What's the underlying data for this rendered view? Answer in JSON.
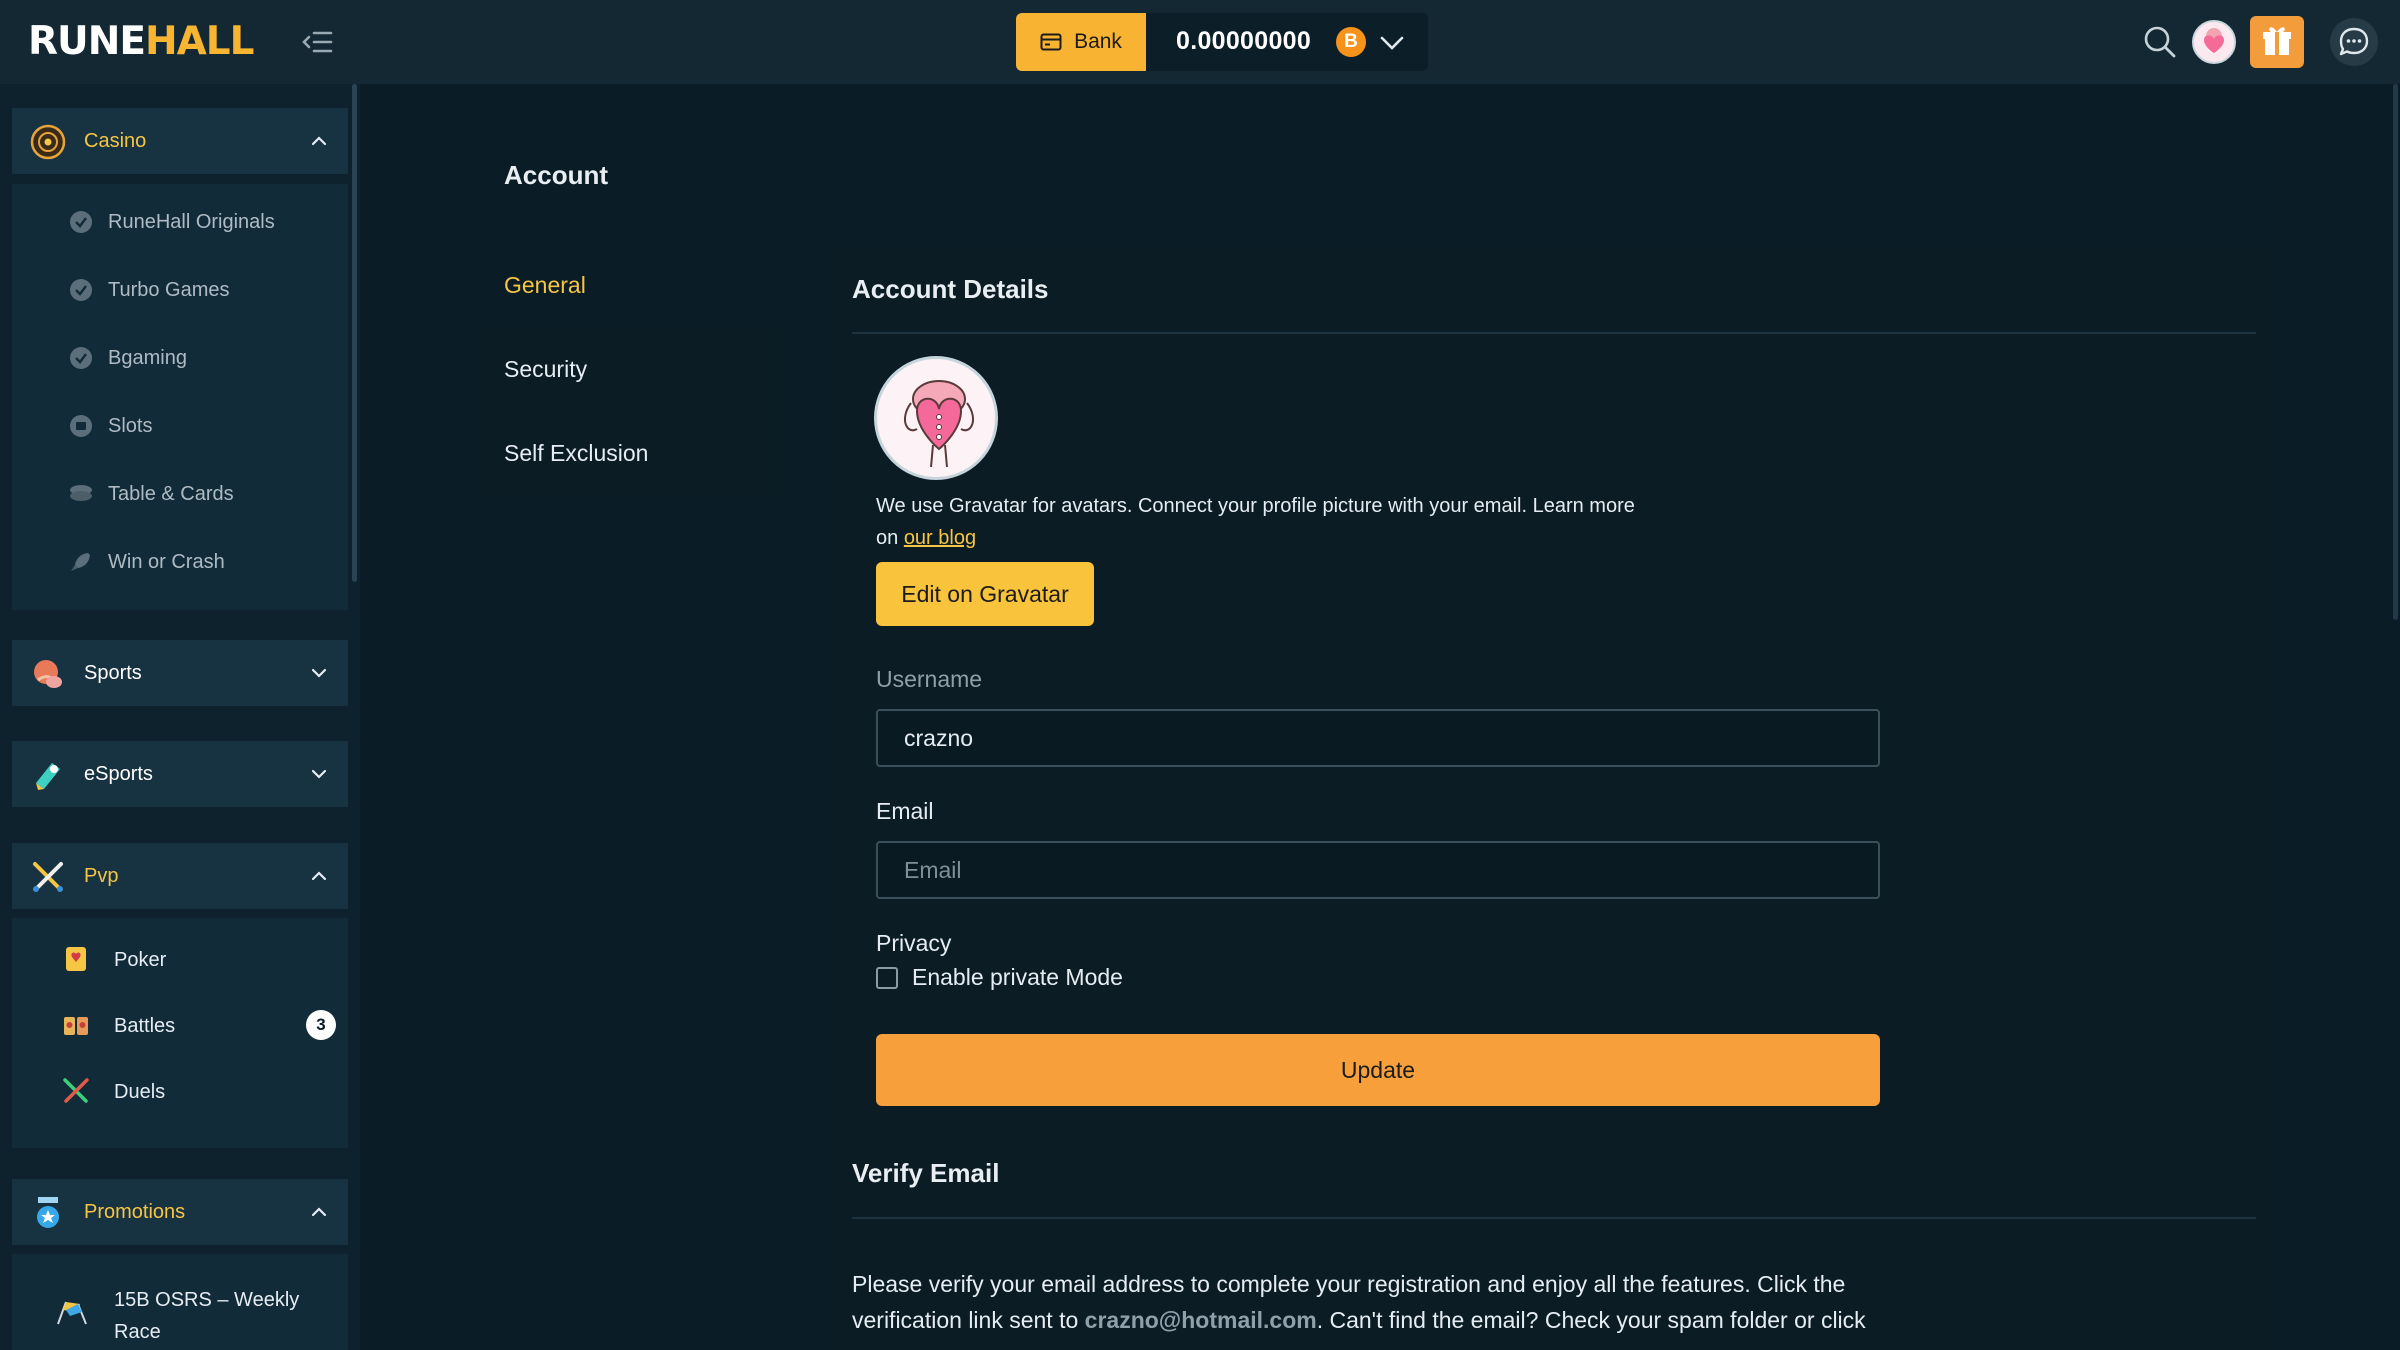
{
  "header": {
    "logo_part1": "RUNE",
    "logo_part2": "HALL",
    "bank_label": "Bank",
    "balance": "0.00000000",
    "currency_symbol": "B"
  },
  "sidebar": {
    "casino": {
      "label": "Casino",
      "items": [
        {
          "label": "RuneHall Originals"
        },
        {
          "label": "Turbo Games"
        },
        {
          "label": "Bgaming"
        },
        {
          "label": "Slots"
        },
        {
          "label": "Table & Cards"
        },
        {
          "label": "Win or Crash"
        }
      ]
    },
    "sports": {
      "label": "Sports"
    },
    "esports": {
      "label": "eSports"
    },
    "pvp": {
      "label": "Pvp",
      "items": [
        {
          "label": "Poker"
        },
        {
          "label": "Battles",
          "badge": "3"
        },
        {
          "label": "Duels"
        }
      ]
    },
    "promotions": {
      "label": "Promotions",
      "items": [
        {
          "label_line1": "15B OSRS – Weekly",
          "label_line2": "Race"
        }
      ]
    }
  },
  "main": {
    "title": "Account",
    "tabs": [
      {
        "label": "General",
        "active": true
      },
      {
        "label": "Security"
      },
      {
        "label": "Self Exclusion"
      }
    ],
    "account_details": {
      "heading": "Account Details",
      "gravatar_text": "We use Gravatar for avatars. Connect your profile picture with your email. Learn more on ",
      "gravatar_link": "our blog",
      "edit_button": "Edit on Gravatar",
      "username_label": "Username",
      "username_value": "crazno",
      "email_label": "Email",
      "email_placeholder": "Email",
      "privacy_label": "Privacy",
      "private_mode_label": "Enable private Mode",
      "update_button": "Update"
    },
    "verify": {
      "heading": "Verify Email",
      "text_line1": "Please verify your email address to complete your registration and enjoy all the features. Click the",
      "text_line2_a": "verification link sent to ",
      "email": "crazno@hotmail.com",
      "text_line2_b": ". Can't find the email? Check your spam folder or click"
    }
  },
  "colors": {
    "accent_gold": "#f7c544",
    "accent_orange": "#f7a03b",
    "background": "#0a1d27"
  }
}
